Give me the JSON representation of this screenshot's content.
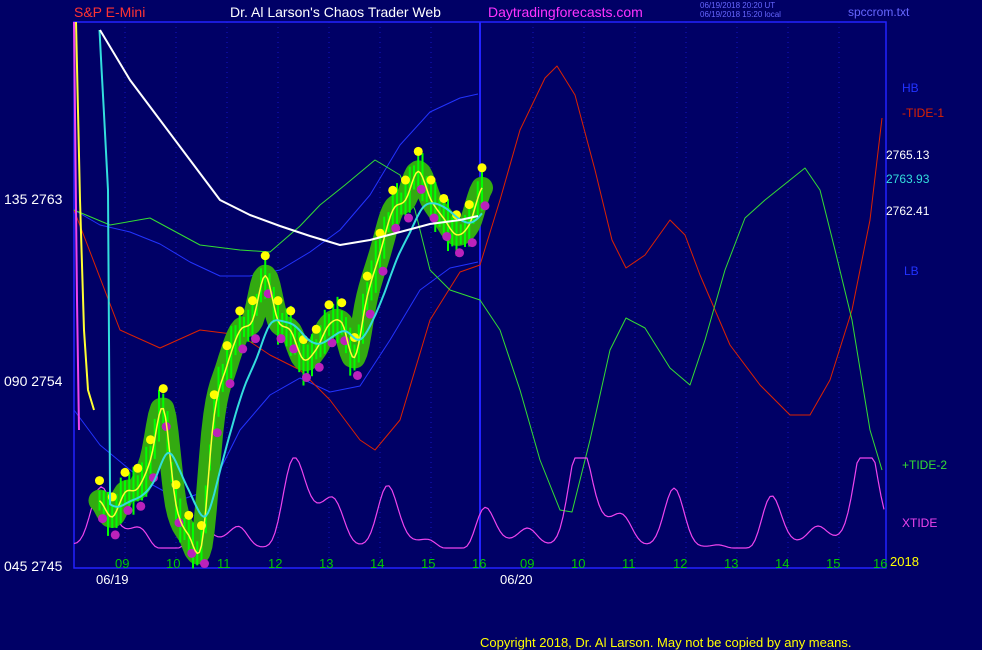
{
  "header": {
    "symbol": "S&P E-Mini",
    "title": "Dr. Al Larson's Chaos Trader Web",
    "site": "Daytradingforecasts.com",
    "stamp_ut": "06/19/2018 20:20 UT",
    "stamp_local": "06/19/2018 15:20 local",
    "filename": "spccrom.txt"
  },
  "colors": {
    "background": "#000066",
    "frame": "#2222ff",
    "symbol": "#ff3333",
    "title": "#ffffff",
    "site": "#ff33ff",
    "band": "#2233ff",
    "tide1": "#dd2200",
    "tide2": "#33dd33",
    "xtide": "#ee44ee",
    "white_ma": "#ffffff",
    "cyan_ma": "#33dddd",
    "yellow_ma": "#ffff33",
    "candles": "#00ff00",
    "highs": "#ffff00",
    "lows": "#bb22bb",
    "halo": "#33aa11"
  },
  "chart_data": {
    "type": "line",
    "title": "S&P E-Mini",
    "y_axis_labels": [
      {
        "text": "135  2763",
        "value": 2763
      },
      {
        "text": "090  2754",
        "value": 2754
      },
      {
        "text": "045  2745",
        "value": 2745
      }
    ],
    "ylim": [
      2745,
      2763
    ],
    "x_hour_labels_day1": [
      "09",
      "10",
      "11",
      "12",
      "13",
      "14",
      "15",
      "16"
    ],
    "x_hour_labels_day2": [
      "09",
      "10",
      "11",
      "12",
      "13",
      "14",
      "15",
      "16"
    ],
    "date_labels": [
      "06/19",
      "06/20"
    ],
    "year_label": "2018",
    "price_labels": [
      {
        "text": "2765.13",
        "value": 2765.13,
        "color": "#ffffff"
      },
      {
        "text": "2763.93",
        "value": 2763.93,
        "color": "#33dddd"
      },
      {
        "text": "2762.41",
        "value": 2762.41,
        "color": "#ffffff"
      }
    ],
    "legend": [
      {
        "name": "HB",
        "color": "#2233ff"
      },
      {
        "name": "-TIDE-1",
        "color": "#dd2200"
      },
      {
        "name": "LB",
        "color": "#2233ff"
      },
      {
        "name": "+TIDE-2",
        "color": "#33dd33"
      },
      {
        "name": "XTIDE",
        "color": "#ee44ee"
      }
    ],
    "time_axis": "hours; day 1 = 06/19 from 8.5 to 16.0, day 2 = 06/20 from 16.0 (=8.0 next day) to 16.0",
    "series": [
      {
        "name": "S&P E-Mini price (bar closes)",
        "x": [
          8.5,
          8.75,
          9.0,
          9.25,
          9.5,
          9.75,
          10.0,
          10.25,
          10.5,
          10.75,
          11.0,
          11.25,
          11.5,
          11.75,
          12.0,
          12.25,
          12.5,
          12.75,
          13.0,
          13.25,
          13.5,
          13.75,
          14.0,
          14.25,
          14.5,
          14.75,
          15.0,
          15.25,
          15.5,
          15.75,
          16.0
        ],
        "values": [
          2748.2,
          2747.4,
          2748.6,
          2748.8,
          2750.2,
          2752.7,
          2748.0,
          2746.5,
          2746.0,
          2752.4,
          2754.8,
          2756.5,
          2757.0,
          2759.2,
          2757.0,
          2756.5,
          2755.1,
          2755.6,
          2756.8,
          2756.9,
          2755.2,
          2758.2,
          2760.3,
          2762.4,
          2762.9,
          2764.3,
          2762.9,
          2762.0,
          2761.2,
          2761.7,
          2763.5
        ]
      },
      {
        "name": "XTIDE (oscillator)",
        "values": []
      }
    ]
  },
  "copyright": "Copyright 2018, Dr. Al Larson. May not be copied by any means."
}
